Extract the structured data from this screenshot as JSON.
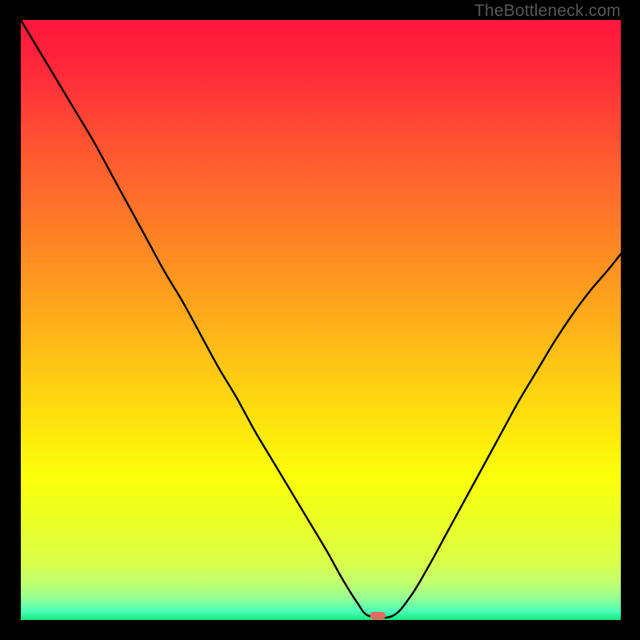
{
  "watermark": {
    "text": "TheBottleneck.com"
  },
  "chart_data": {
    "type": "line",
    "title": "",
    "xlabel": "",
    "ylabel": "",
    "xlim": [
      0,
      100
    ],
    "ylim": [
      0,
      100
    ],
    "grid": false,
    "legend": false,
    "background_gradient": {
      "stops": [
        {
          "offset": 0.0,
          "color": "#ff163d"
        },
        {
          "offset": 0.09,
          "color": "#ff2b3a"
        },
        {
          "offset": 0.2,
          "color": "#ff5132"
        },
        {
          "offset": 0.32,
          "color": "#ff7529"
        },
        {
          "offset": 0.44,
          "color": "#ff9a1f"
        },
        {
          "offset": 0.55,
          "color": "#ffbe16"
        },
        {
          "offset": 0.66,
          "color": "#ffe00d"
        },
        {
          "offset": 0.76,
          "color": "#fbff09"
        },
        {
          "offset": 0.84,
          "color": "#eaff27"
        },
        {
          "offset": 0.905,
          "color": "#daff4b"
        },
        {
          "offset": 0.94,
          "color": "#c0ff72"
        },
        {
          "offset": 0.965,
          "color": "#92ff95"
        },
        {
          "offset": 0.985,
          "color": "#4dffb8"
        },
        {
          "offset": 1.0,
          "color": "#17e87d"
        }
      ]
    },
    "series": [
      {
        "name": "bottleneck-curve",
        "color": "#000000",
        "x": [
          0,
          3,
          6,
          9,
          12,
          15,
          18,
          21,
          24,
          27,
          30,
          33,
          36,
          39,
          42,
          45,
          48,
          51,
          53.5,
          56,
          58,
          62,
          65,
          68,
          71,
          74,
          77,
          80,
          83,
          86,
          89,
          92,
          95,
          98,
          100
        ],
        "y": [
          100,
          95,
          90,
          85,
          80,
          74.5,
          69,
          63.5,
          58,
          53,
          47.5,
          42,
          37,
          31.5,
          26.5,
          21.5,
          16.5,
          11.5,
          7,
          3,
          0.7,
          0.7,
          4,
          9,
          14.5,
          20,
          25.5,
          31,
          36.5,
          41.5,
          46.5,
          51,
          55,
          58.5,
          61
        ]
      }
    ],
    "annotations": [
      {
        "name": "optimal-marker",
        "shape": "rounded-pill",
        "x": 59.5,
        "y": 0.7,
        "color": "#e46a5e",
        "width_pct": 2.6,
        "height_pct": 1.3
      }
    ]
  }
}
